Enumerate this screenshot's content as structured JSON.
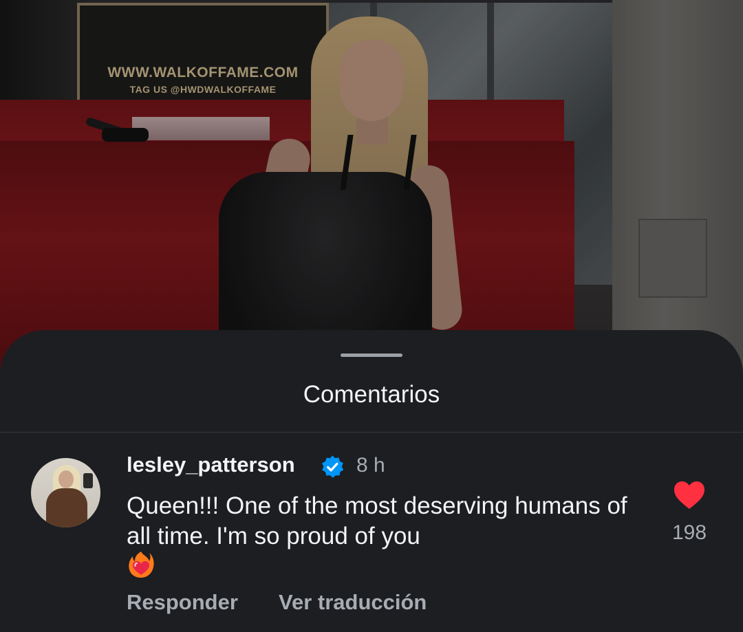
{
  "background_sign": {
    "line1": "WWW.WALKOFFAME.COM",
    "line2": "TAG US @HWDWALKOFFAME"
  },
  "sheet": {
    "title": "Comentarios"
  },
  "comment": {
    "username": "lesley_patterson",
    "verified": true,
    "time": "8 h",
    "text": "Queen!!! One of the most deserving humans of all time. I'm so proud of you",
    "emoji": "heart-on-fire",
    "like_count": "198",
    "reply_label": "Responder",
    "translate_label": "Ver traducción"
  },
  "colors": {
    "sheet_bg": "#1c1e21",
    "text_primary": "#f2f4f6",
    "text_secondary": "#a8adb3",
    "like_red": "#ff3040",
    "verified_blue": "#0095f6"
  }
}
